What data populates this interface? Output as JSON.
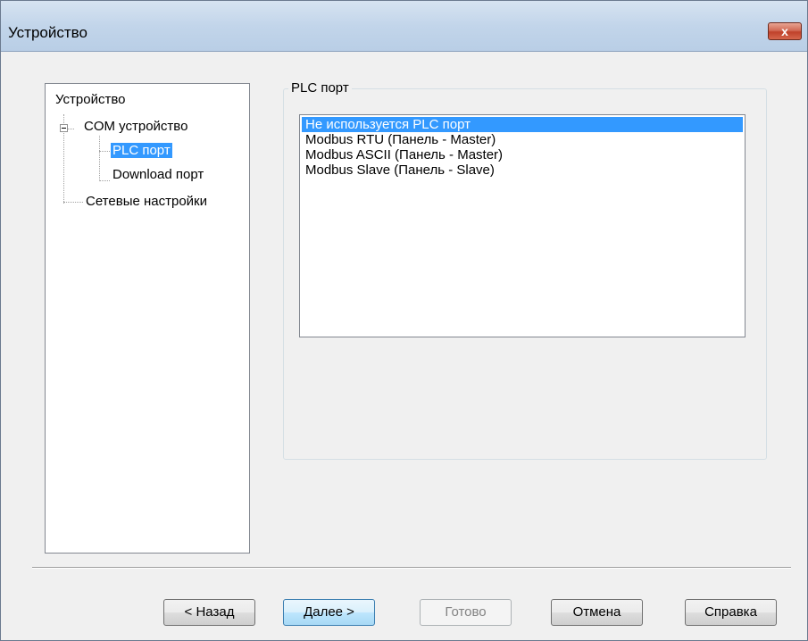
{
  "window": {
    "title": "Устройство",
    "close_label": "x"
  },
  "tree": {
    "root": "Устройство",
    "com": "COM устройство",
    "plc_port": "PLC порт",
    "download_port": "Download порт",
    "network": "Сетевые настройки"
  },
  "group": {
    "title": "PLC порт",
    "items": [
      "Не используется PLC порт",
      "Modbus RTU (Панель - Master)",
      "Modbus ASCII (Панель - Master)",
      "Modbus Slave (Панель - Slave)"
    ],
    "selected_index": 0
  },
  "buttons": {
    "back": "< Назад",
    "next": "Далее >",
    "finish": "Готово",
    "cancel": "Отмена",
    "help": "Справка"
  }
}
